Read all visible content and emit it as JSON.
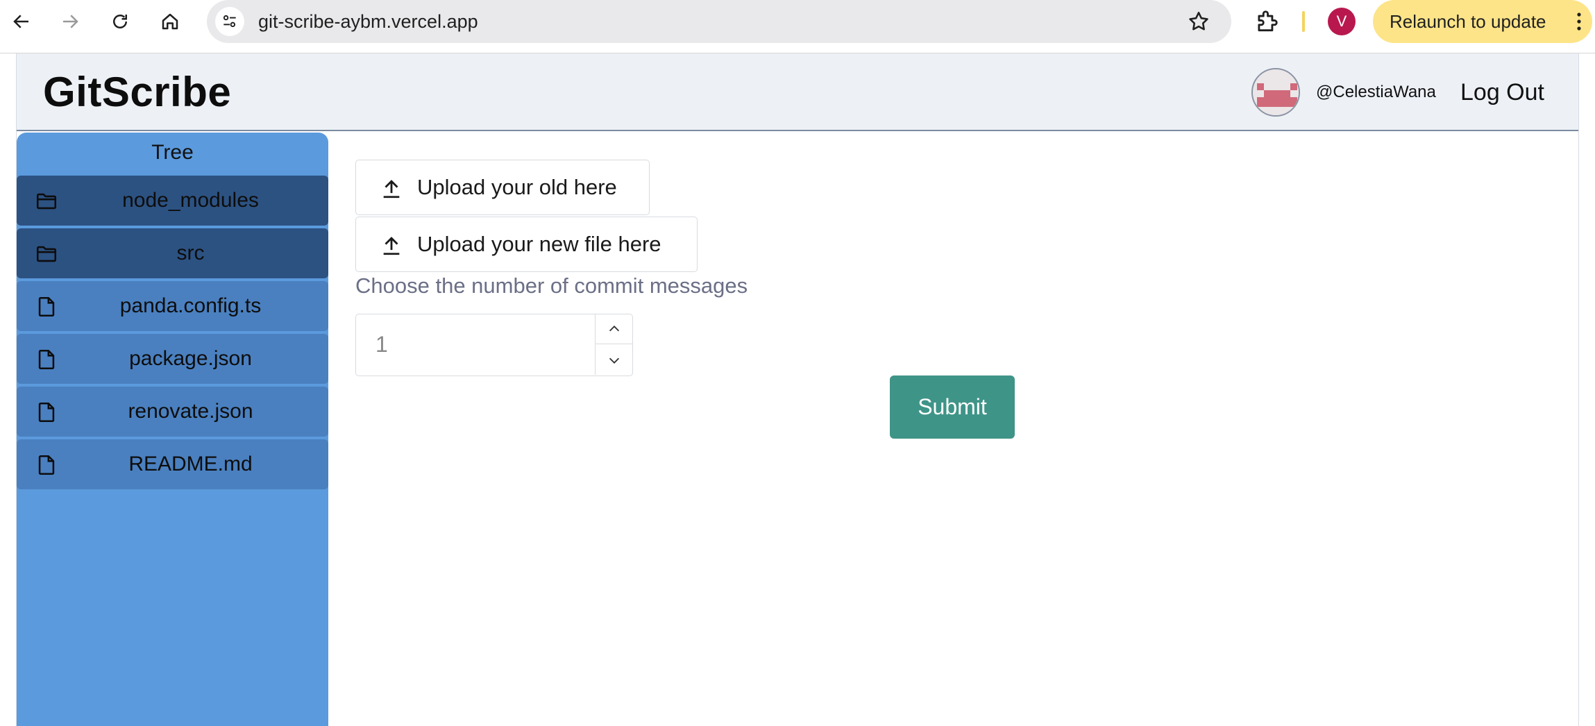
{
  "browser": {
    "url": "git-scribe-aybm.vercel.app",
    "profile_initial": "V",
    "relaunch_label": "Relaunch to update"
  },
  "header": {
    "brand": "GitScribe",
    "username": "@CelestiaWana",
    "logout_label": "Log Out"
  },
  "tree": {
    "title": "Tree",
    "items": [
      {
        "label": "node_modules",
        "kind": "folder"
      },
      {
        "label": "src",
        "kind": "folder"
      },
      {
        "label": "panda.config.ts",
        "kind": "file"
      },
      {
        "label": "package.json",
        "kind": "file"
      },
      {
        "label": "renovate.json",
        "kind": "file"
      },
      {
        "label": "README.md",
        "kind": "file"
      }
    ]
  },
  "main": {
    "upload_old_label": "Upload your old here",
    "upload_new_label": "Upload your new file here",
    "choose_label": "Choose the number of commit messages",
    "count_value": "1",
    "submit_label": "Submit"
  },
  "colors": {
    "sidebar": "#5b9add",
    "folder_item": "#2c5282",
    "file_item": "#4a80c0",
    "submit": "#3f9488",
    "relaunch": "#fde488"
  }
}
